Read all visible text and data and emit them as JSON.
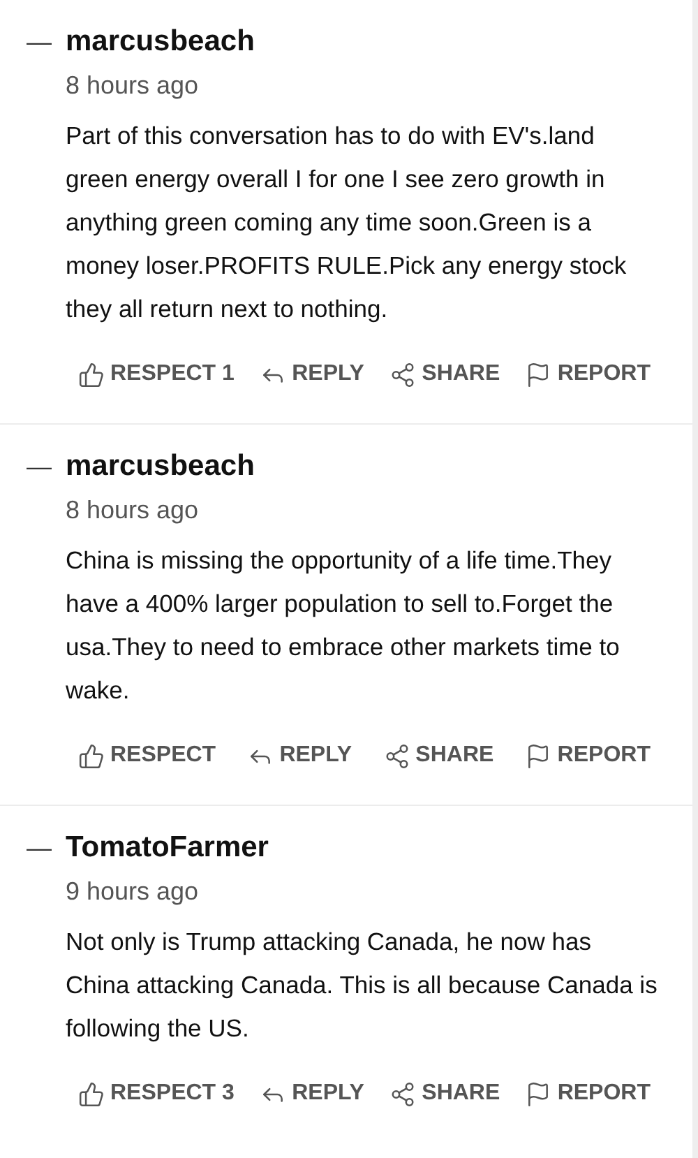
{
  "comments": [
    {
      "author": "marcusbeach",
      "time": "8 hours ago",
      "collapse_symbol": "—",
      "text": "Part of this conversation has to do with EV's.land green energy overall I for one I see zero growth in anything green coming any time soon.Green is a money loser.PROFITS RULE.Pick any energy stock they all return next to nothing.",
      "actions": [
        "RESPECT 1",
        "REPLY",
        "SHARE",
        "REPORT"
      ]
    },
    {
      "author": "marcusbeach",
      "time": "8 hours ago",
      "collapse_symbol": "—",
      "text": "China is missing the opportunity of a life time.They have a 400% larger population to sell to.Forget the usa.They to need to embrace other markets time to wake.",
      "actions": [
        "RESPECT",
        "REPLY",
        "SHARE",
        "REPORT"
      ]
    },
    {
      "author": "TomatoFarmer",
      "time": "9 hours ago",
      "collapse_symbol": "—",
      "text": "Not only is Trump attacking Canada, he now has China attacking Canada. This is all because Canada is following the US.",
      "actions": [
        "RESPECT 3",
        "REPLY",
        "SHARE",
        "REPORT"
      ]
    }
  ]
}
